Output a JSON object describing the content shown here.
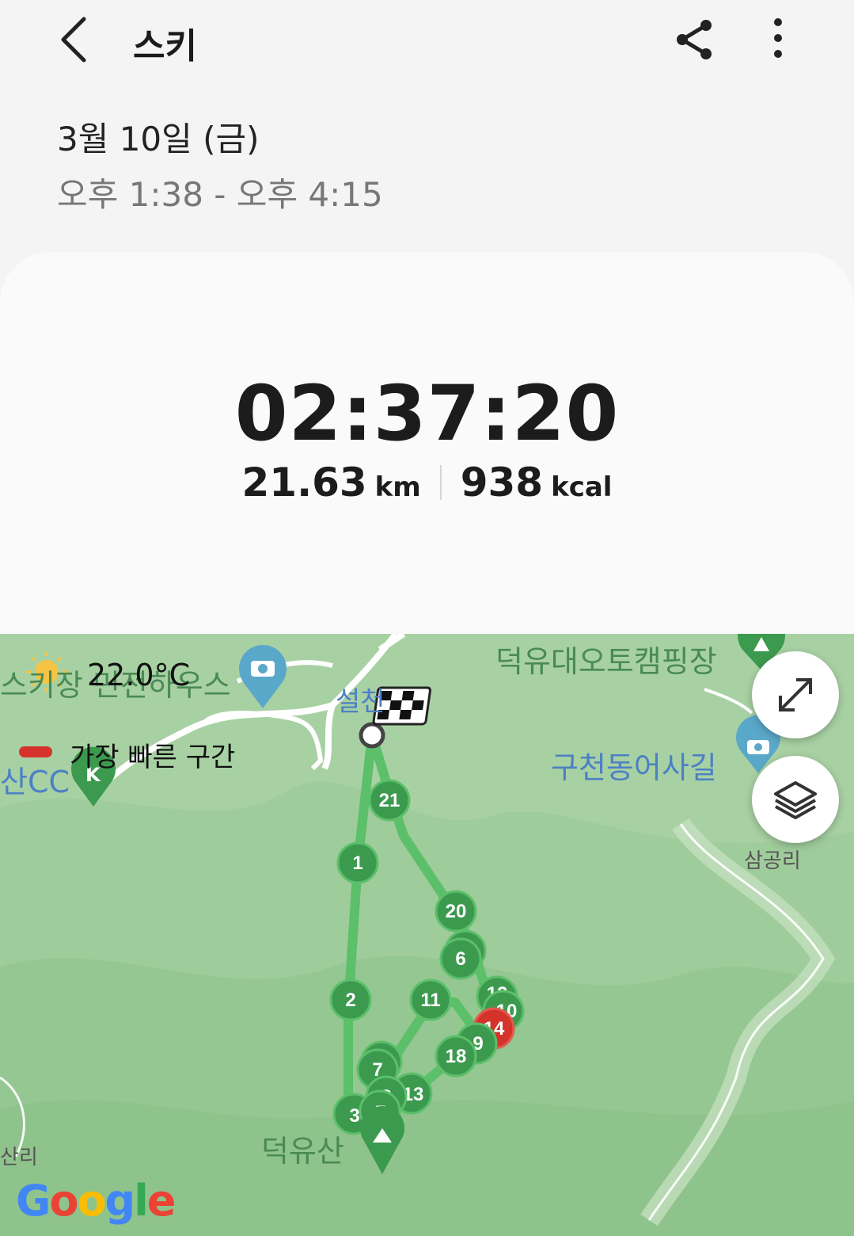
{
  "header": {
    "title": "스키"
  },
  "session": {
    "date": "3월 10일 (금)",
    "time_range": "오후 1:38 - 오후 4:15"
  },
  "summary": {
    "duration": "02:37:20",
    "distance_value": "21.63",
    "distance_unit": "km",
    "calories_value": "938",
    "calories_unit": "kcal"
  },
  "map": {
    "temperature": "22.0°C",
    "legend_fastest": "가장 빠른 구간",
    "labels": {
      "ski_guesthouse": "스키장 민전하우스",
      "camping": "덕유대오토캠핑장",
      "seolcheon": "설천",
      "gucheondong": "구천동어사길",
      "samgongri": "삼공리",
      "deogyusan": "덕유산",
      "cc": "산CC",
      "sanri": "산리",
      "k": "K"
    },
    "markers": [
      "21",
      "1",
      "20",
      "6",
      "11",
      "2",
      "7",
      "18",
      "9",
      "14",
      "13",
      "8",
      "3",
      "7",
      "10",
      "12"
    ],
    "route_color": "#5cbf6a",
    "marker_color": "#3c9a4f",
    "fastest_color": "#d4322a",
    "google_logo": "Google"
  },
  "icons": {
    "back": "chevron-left-icon",
    "share": "share-icon",
    "more": "more-vertical-icon",
    "expand": "expand-icon",
    "layers": "layers-icon"
  }
}
